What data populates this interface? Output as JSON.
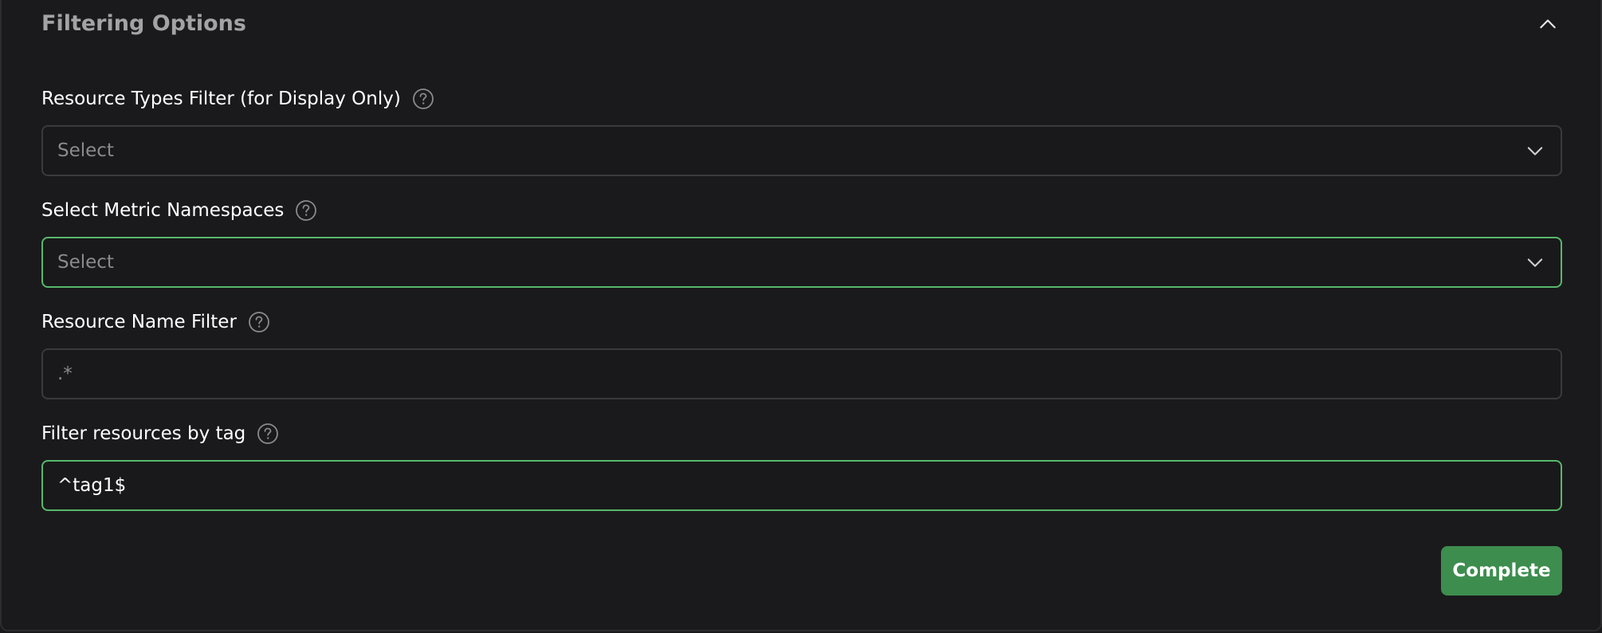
{
  "panel": {
    "title": "Filtering Options",
    "collapse_icon": "chevron-up-icon"
  },
  "fields": [
    {
      "label": "Resource Types Filter (for Display Only)",
      "type": "select",
      "placeholder": "Select",
      "value": "",
      "focused": false
    },
    {
      "label": "Select Metric Namespaces",
      "type": "select",
      "placeholder": "Select",
      "value": "",
      "focused": true
    },
    {
      "label": "Resource Name Filter",
      "type": "text",
      "placeholder": ".*",
      "value": "",
      "focused": false
    },
    {
      "label": "Filter resources by tag",
      "type": "text",
      "placeholder": "",
      "value": "^tag1$",
      "focused": true
    }
  ],
  "actions": {
    "complete_label": "Complete"
  },
  "colors": {
    "background": "#1a1a1c",
    "accent_green": "#57b86a",
    "button_green": "#3d8d4e",
    "muted_text": "#8a8a8e"
  }
}
